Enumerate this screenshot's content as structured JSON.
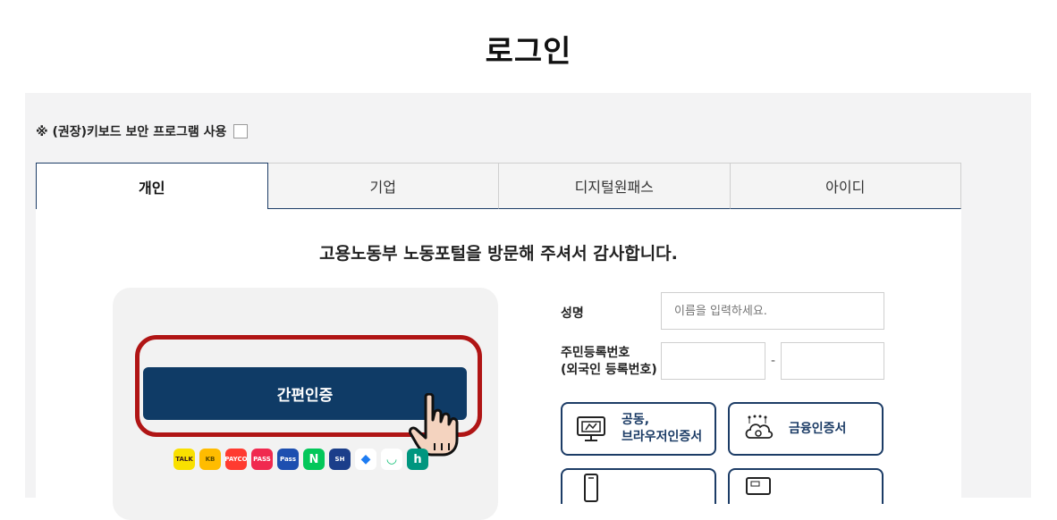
{
  "page": {
    "title": "로그인"
  },
  "keyboard_security": {
    "label": "※ (권장)키보드 보안 프로그램 사용",
    "checked": false
  },
  "tabs": [
    {
      "label": "개인",
      "active": true
    },
    {
      "label": "기업",
      "active": false
    },
    {
      "label": "디지털원패스",
      "active": false
    },
    {
      "label": "아이디",
      "active": false
    }
  ],
  "welcome": "고용노동부 노동포털을 방문해 주셔서 감사합니다.",
  "simple_auth": {
    "button_label": "간편인증"
  },
  "auth_apps": [
    {
      "name": "kakaotalk",
      "label": "TALK",
      "bg": "#f9e000",
      "fg": "#3c1e1e"
    },
    {
      "name": "kb",
      "label": "KB",
      "bg": "#ffbc00",
      "fg": "#5a4a00"
    },
    {
      "name": "payco",
      "label": "PAYCO",
      "bg": "#ff3b30",
      "fg": "#ffffff"
    },
    {
      "name": "pass",
      "label": "PASS",
      "bg": "#f0294f",
      "fg": "#ffffff"
    },
    {
      "name": "samsung-pass",
      "label": "Pass",
      "bg": "#1d4fb0",
      "fg": "#ffffff"
    },
    {
      "name": "naver",
      "label": "N",
      "bg": "#03c75a",
      "fg": "#ffffff"
    },
    {
      "name": "shinhan",
      "label": "SH",
      "bg": "#1b3e8a",
      "fg": "#ffffff"
    },
    {
      "name": "toss",
      "label": "◆",
      "bg": "#ffffff",
      "fg": "#1e7cf2"
    },
    {
      "name": "banksalad",
      "label": "◡",
      "bg": "#ffffff",
      "fg": "#19c27a"
    },
    {
      "name": "hana",
      "label": "h",
      "bg": "#00967f",
      "fg": "#ffffff"
    }
  ],
  "form": {
    "name_label": "성명",
    "name_placeholder": "이름을 입력하세요.",
    "rrn_label_1": "주민등록번호",
    "rrn_label_2": "(외국인 등록번호)",
    "rrn_separator": "-"
  },
  "cert_buttons": {
    "joint_line1": "공동,",
    "joint_line2": "브라우저인증서",
    "financial": "금융인증서"
  },
  "colors": {
    "navy": "#0f3b66",
    "highlight_red": "#b01515",
    "panel_gray": "#f3f3f4"
  }
}
